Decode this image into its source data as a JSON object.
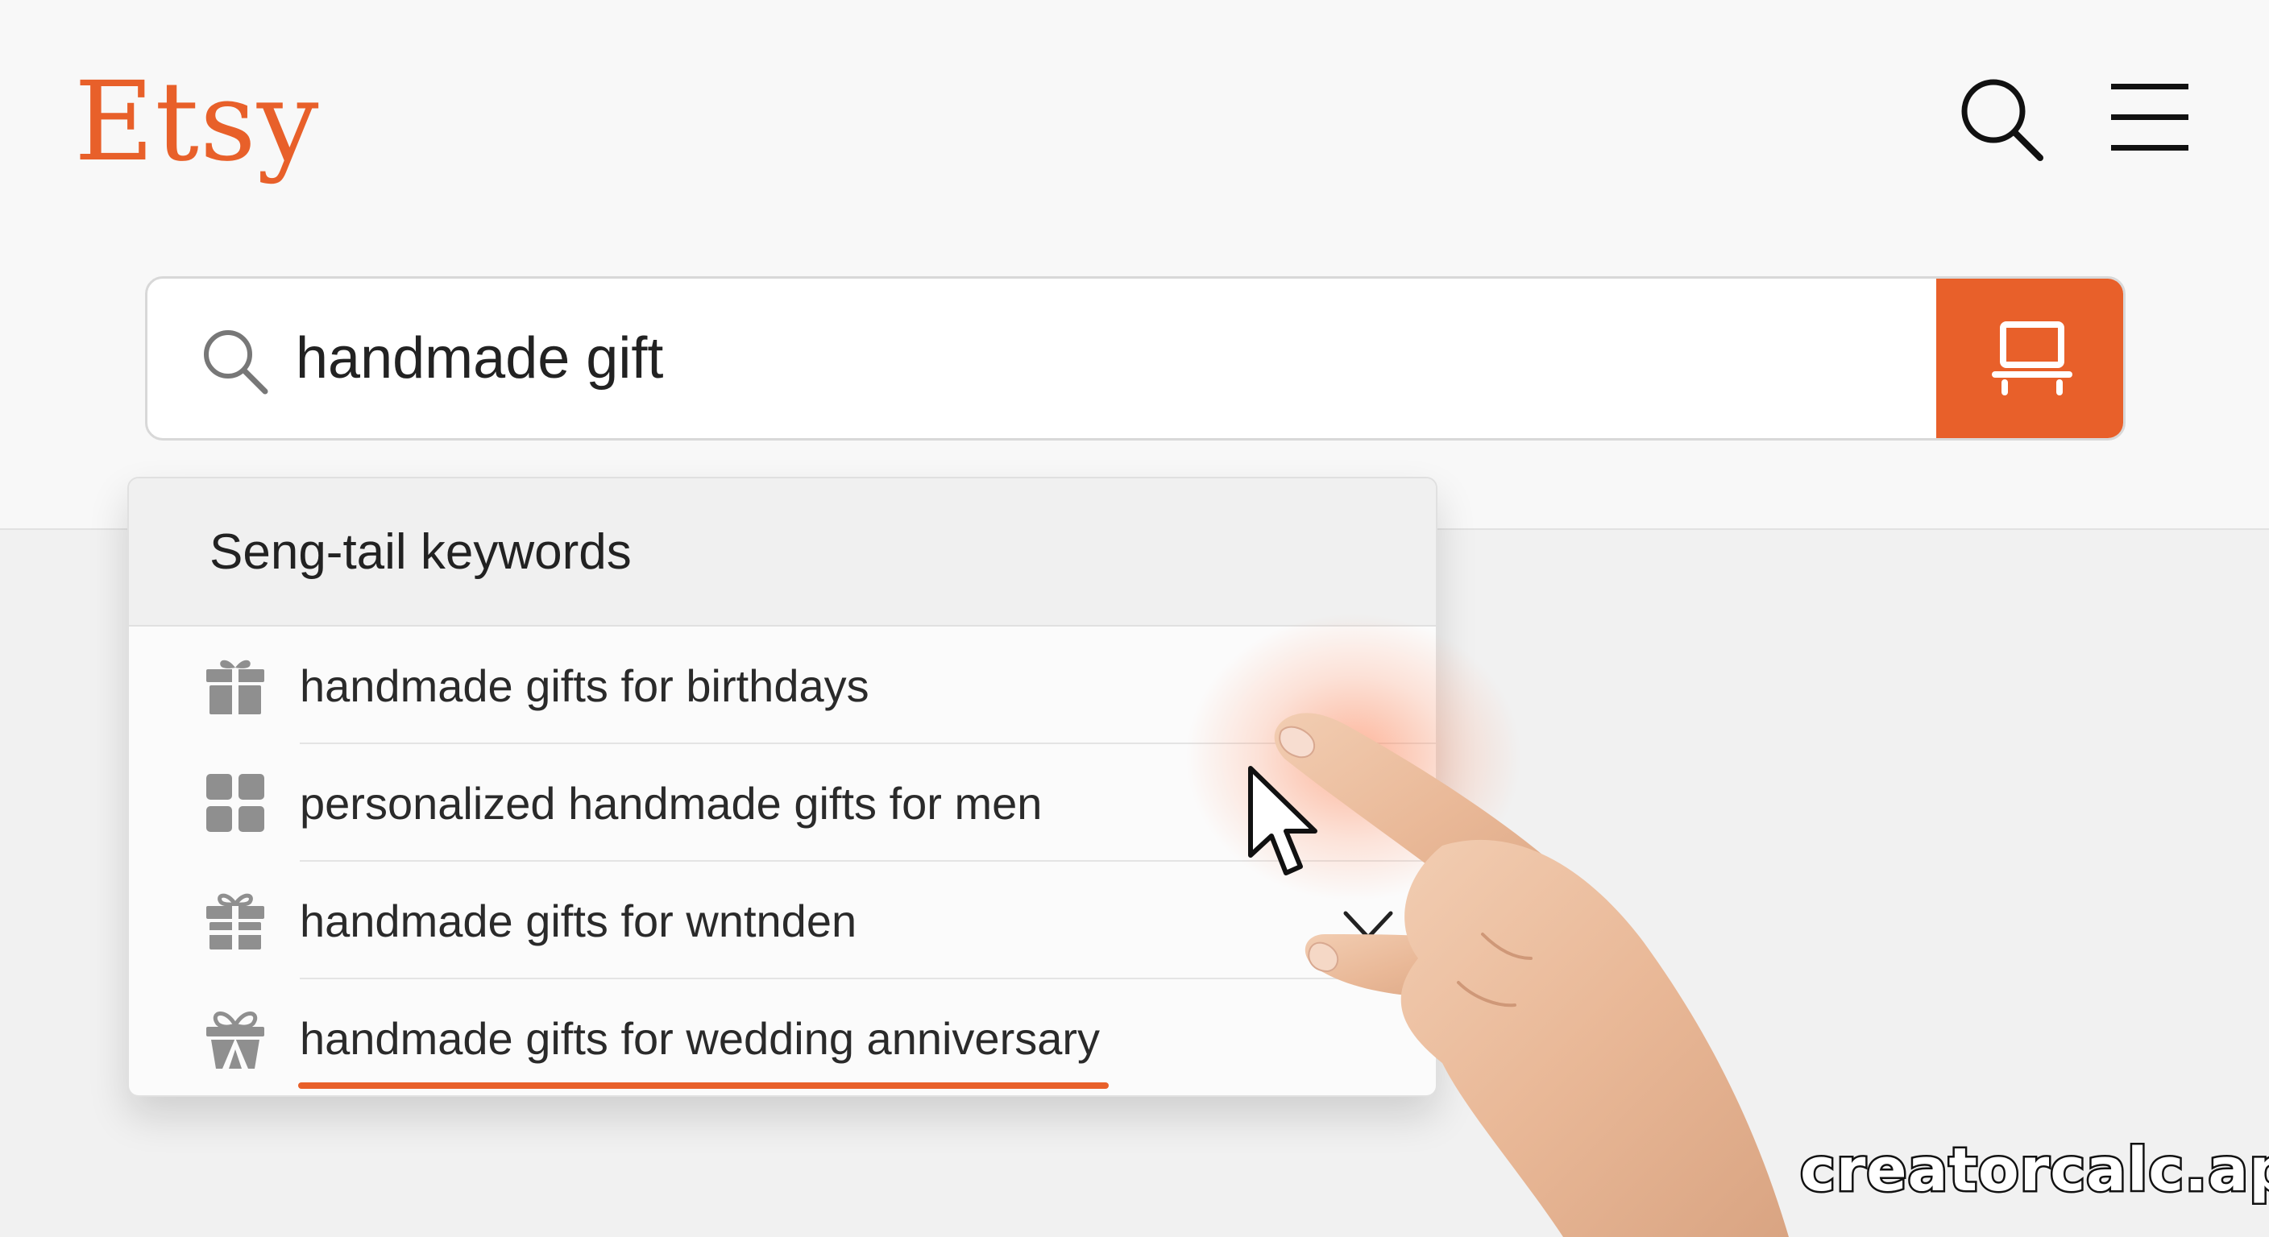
{
  "header": {
    "logo_text": "Etsy",
    "brand_color": "#e8602a",
    "icons": {
      "search": "search-icon",
      "menu": "hamburger-menu-icon"
    }
  },
  "search": {
    "value": "handmade gift",
    "placeholder": "",
    "submit_icon": "monitor-icon"
  },
  "dropdown": {
    "header": "Seng-tail keywords",
    "items": [
      {
        "label": "handmade gifts for birthdays",
        "icon": "gift-icon"
      },
      {
        "label": "personalized handmade gifts for men",
        "icon": "grid-icon"
      },
      {
        "label": "handmade gifts for wntnden",
        "icon": "gift-icon"
      },
      {
        "label": "handmade gifts for wedding anniversary",
        "icon": "gift-bow-icon"
      }
    ],
    "selected_index": 3
  },
  "overlay": {
    "cursor_icon": "arrow-cursor-icon",
    "hand": "pointing-hand",
    "chevron_icon": "chevron-down-icon"
  },
  "watermark": "creatorcalc.app"
}
